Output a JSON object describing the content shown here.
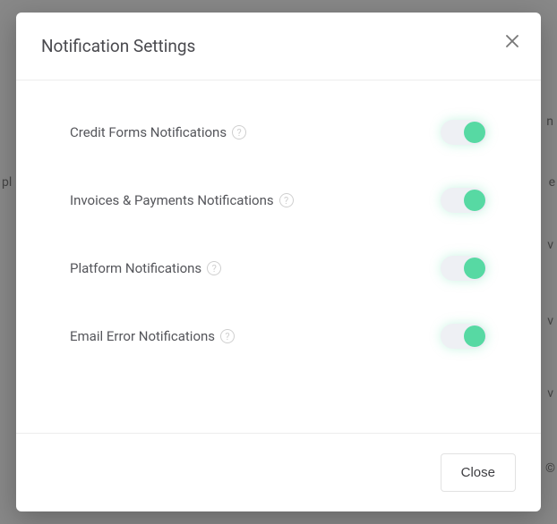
{
  "modal": {
    "title": "Notification Settings",
    "closeButtonLabel": "Close",
    "settings": [
      {
        "label": "Credit Forms Notifications",
        "enabled": true
      },
      {
        "label": "Invoices & Payments Notifications",
        "enabled": true
      },
      {
        "label": "Platform Notifications",
        "enabled": true
      },
      {
        "label": "Email Error Notifications",
        "enabled": true
      }
    ]
  },
  "colors": {
    "toggleKnob": "#57d9a3",
    "toggleTrack": "#eef0f4"
  }
}
